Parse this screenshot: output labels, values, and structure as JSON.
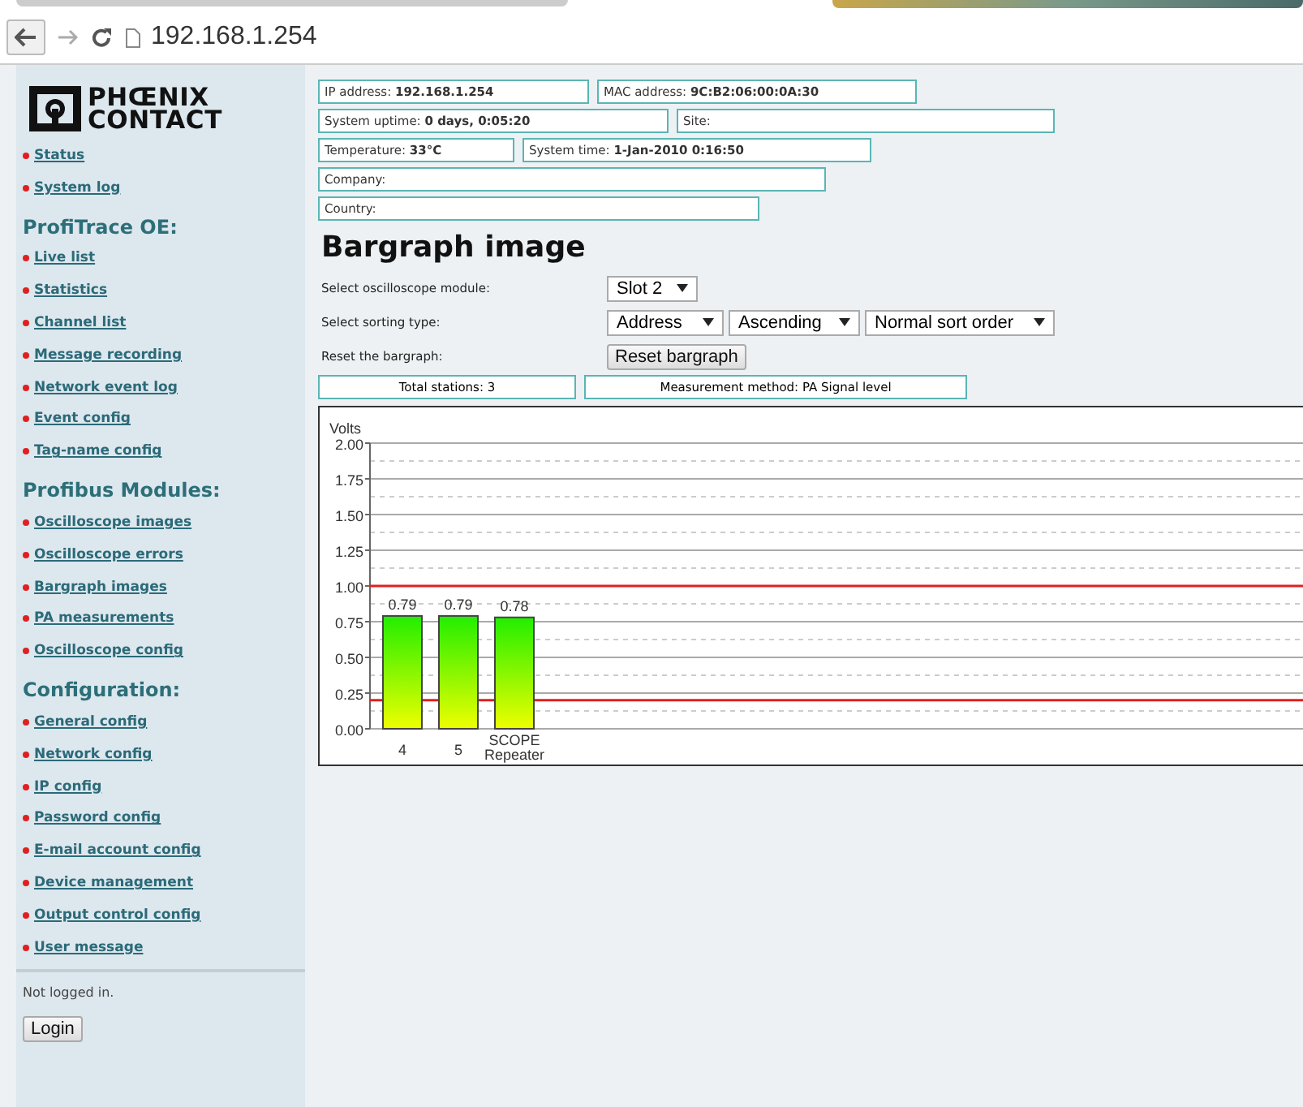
{
  "browser": {
    "url": "192.168.1.254"
  },
  "sidebar": {
    "logo": [
      "PHŒNIX",
      "CONTACT"
    ],
    "sections": [
      {
        "items": [
          "Status",
          "System log"
        ]
      },
      {
        "heading": "ProfiTrace OE:",
        "items": [
          "Live list",
          "Statistics",
          "Channel list",
          "Message recording",
          "Network event log",
          "Event config",
          "Tag-name config"
        ]
      },
      {
        "heading": "Profibus Modules:",
        "items": [
          "Oscilloscope images",
          "Oscilloscope errors",
          "Bargraph images",
          "PA measurements",
          "Oscilloscope config"
        ]
      },
      {
        "heading": "Configuration:",
        "items": [
          "General config",
          "Network config",
          "IP config",
          "Password config",
          "E-mail account config",
          "Device management",
          "Output control config",
          "User message"
        ]
      }
    ],
    "login_status": "Not logged in.",
    "login_button": "Login"
  },
  "info_rows": [
    [
      {
        "label": "IP address:",
        "value": "192.168.1.254"
      },
      {
        "label": "MAC address:",
        "value": "9C:B2:06:00:0A:30"
      }
    ],
    [
      {
        "label": "System uptime:",
        "value": "0 days, 0:05:20"
      },
      {
        "label": "Site:"
      }
    ],
    [
      {
        "label": "Temperature:",
        "value": "33°C"
      },
      {
        "label": "System time:",
        "value": "1-Jan-2010 0:16:50"
      }
    ],
    [
      {
        "label": "Company:"
      }
    ],
    [
      {
        "label": "Country:"
      }
    ]
  ],
  "heading": "Bargraph image",
  "form": [
    {
      "label": "Select oscilloscope module:",
      "kind": "select",
      "controls": [
        "Slot 2"
      ]
    },
    {
      "label": "Select sorting type:",
      "kind": "select",
      "controls": [
        "Address",
        "Ascending",
        "Normal sort order"
      ]
    },
    {
      "label": "Reset the bargraph:",
      "kind": "button",
      "controls": [
        "Reset bargraph"
      ]
    }
  ],
  "summary": [
    "Total stations: 3",
    "Measurement method: PA Signal level"
  ],
  "chart": {
    "chart_data": {
      "type": "bar",
      "ylabel": "Volts",
      "categories": [
        "4",
        "5",
        "SCOPE Repeater"
      ],
      "values": [
        0.79,
        0.79,
        0.78
      ],
      "ylim": [
        0,
        2
      ],
      "yticks": [
        {
          "value": 0,
          "label": "0.00"
        },
        {
          "value": 0.25,
          "label": "0.25"
        },
        {
          "value": 0.5,
          "label": "0.50"
        },
        {
          "value": 0.75,
          "label": "0.75"
        },
        {
          "value": 1,
          "label": "1.00"
        },
        {
          "value": 1.25,
          "label": "1.25"
        },
        {
          "value": 1.5,
          "label": "1.50"
        },
        {
          "value": 1.75,
          "label": "1.75"
        },
        {
          "value": 2,
          "label": "2.00"
        }
      ],
      "data_labels": true,
      "grid": true,
      "ref_lines": [
        {
          "axis": "y",
          "value": 1,
          "color": "#e02020"
        },
        {
          "axis": "y",
          "value": 0.2,
          "color": "#e02020"
        }
      ]
    }
  }
}
